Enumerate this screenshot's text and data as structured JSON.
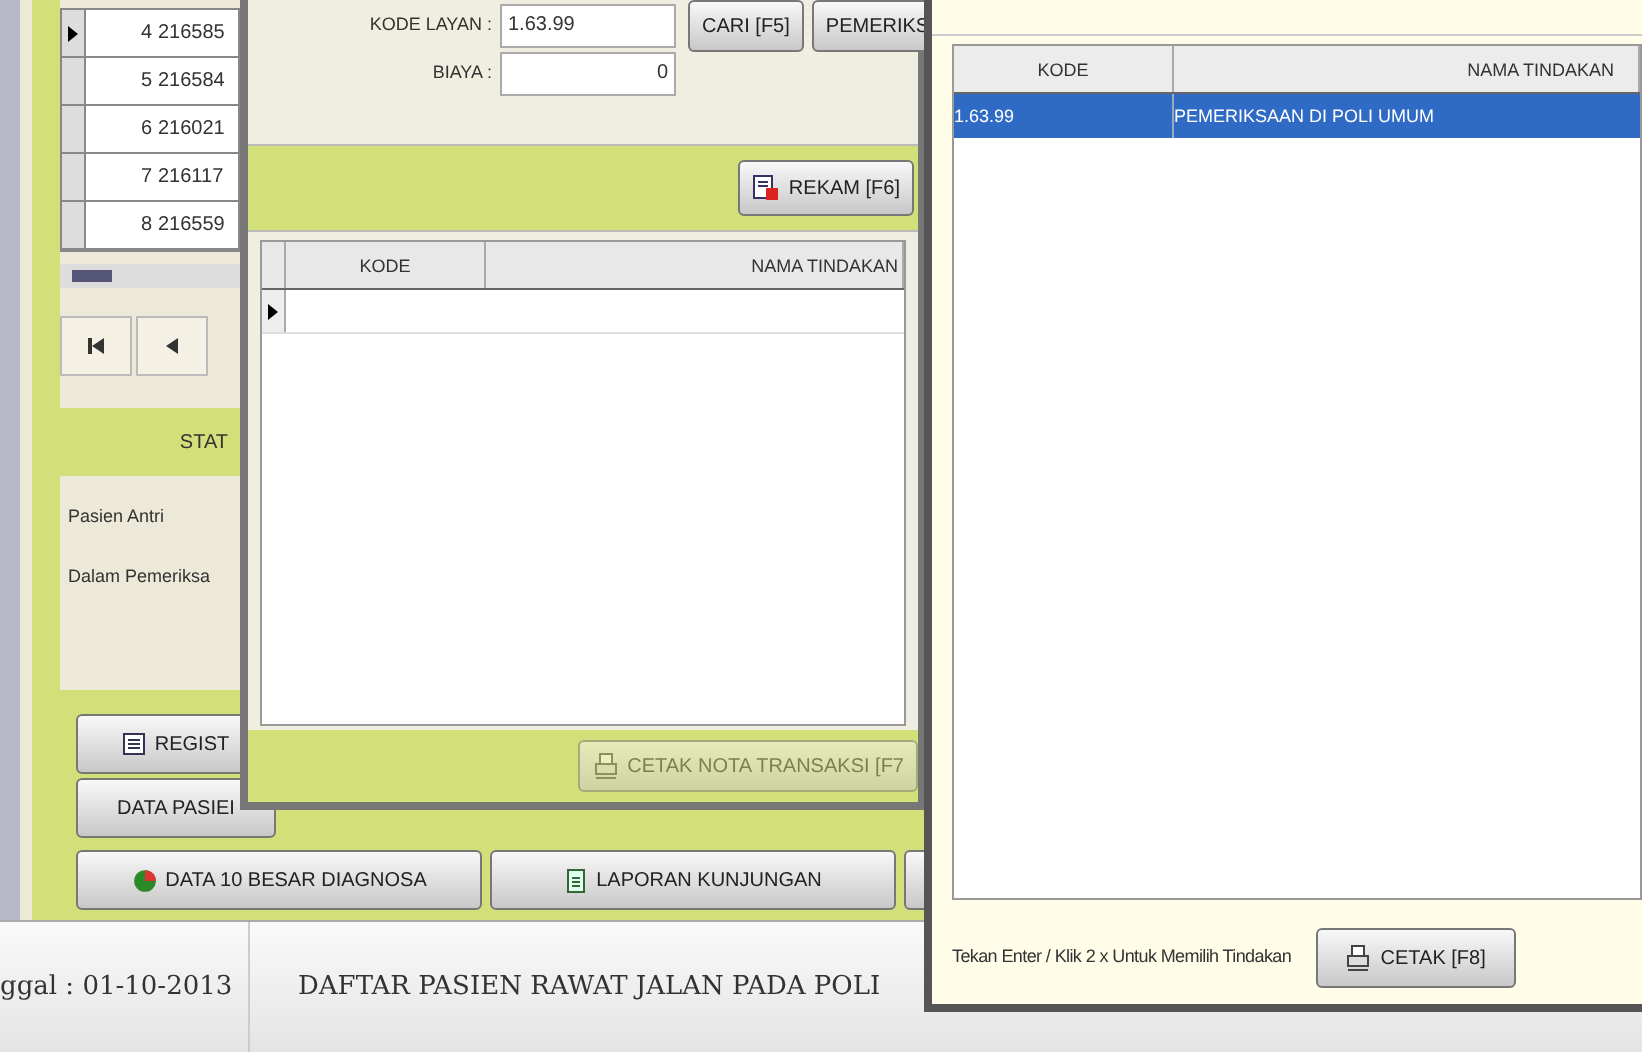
{
  "main_window": {
    "patients_table": {
      "rows": [
        {
          "number": "4",
          "code": "216585",
          "selected": true
        },
        {
          "number": "5",
          "code": "216584",
          "selected": false
        },
        {
          "number": "6",
          "code": "216021",
          "selected": false
        },
        {
          "number": "7",
          "code": "216117",
          "selected": false
        },
        {
          "number": "8",
          "code": "216559",
          "selected": false
        }
      ]
    },
    "status_panel": {
      "title": "STAT",
      "items": [
        "Pasien Antri",
        "Dalam Pemeriksa"
      ]
    },
    "side_buttons": [
      {
        "label": "REGIST",
        "kind": "list"
      },
      {
        "label": "DATA PASIEI",
        "kind": "plain"
      }
    ],
    "bottom_buttons": [
      {
        "label": "DATA 10 BESAR DIAGNOSA",
        "kind": "chart"
      },
      {
        "label": "LAPORAN KUNJUNGAN",
        "kind": "report"
      },
      {
        "kind": "plain"
      }
    ],
    "status_bar": {
      "date": "ggal : 01-10-2013",
      "title": "DAFTAR PASIEN RAWAT JALAN PADA POLI"
    }
  },
  "tindakan_window": {
    "fields": [
      {
        "label": "KODE LAYAN :",
        "value": "1.63.99",
        "kind": "text"
      },
      {
        "label": "BIAYA :",
        "value": "0",
        "kind": "number"
      }
    ],
    "search_buttons": [
      "CARI [F5]",
      "PEMERIKS"
    ],
    "save_button": "REKAM [F6]",
    "table": {
      "columns": [
        "KODE",
        "NAMA TINDAKAN"
      ]
    },
    "print_button": {
      "label": "CETAK NOTA TRANSAKSI [F7",
      "disabled": true
    }
  },
  "lookup_window": {
    "table": {
      "columns": [
        "KODE",
        "NAMA TINDAKAN"
      ],
      "rows": [
        {
          "kode": "1.63.99",
          "nama": "PEMERIKSAAN DI POLI UMUM",
          "selected": true
        }
      ]
    },
    "hint": "Tekan Enter / Klik 2 x Untuk Memilih Tindakan",
    "print_button": "CETAK [F8]"
  }
}
